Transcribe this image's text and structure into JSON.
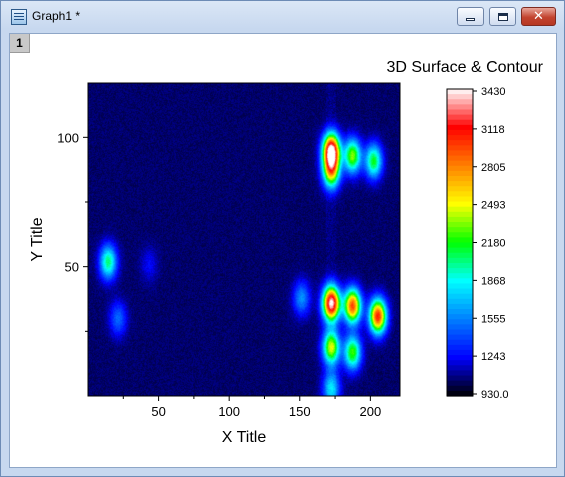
{
  "window": {
    "title": "Graph1 *",
    "layer_tab": "1",
    "buttons": {
      "minimize": "minimize-icon",
      "maximize": "maximize-icon",
      "close": "close-icon"
    }
  },
  "chart_data": {
    "type": "heatmap",
    "title": "3D Surface & Contour",
    "xlabel": "X Title",
    "ylabel": "Y Title",
    "xlim": [
      0,
      221
    ],
    "ylim": [
      0,
      121
    ],
    "x_ticks": [
      50,
      100,
      150,
      200
    ],
    "y_ticks": [
      50,
      100
    ],
    "x_minor_ticks": [
      25,
      75,
      125,
      175
    ],
    "y_minor_ticks": [
      25,
      75
    ],
    "z_range": [
      930.0,
      3430
    ],
    "colorbar_labels": [
      "3430",
      "3118",
      "2805",
      "2493",
      "2180",
      "1868",
      "1555",
      "1243",
      "930.0"
    ],
    "colormap": [
      "#000000",
      "#0000ff",
      "#0080ff",
      "#00ffff",
      "#00ff00",
      "#ffff00",
      "#ff8000",
      "#ff0000",
      "#ffffff"
    ],
    "background_level": 1060,
    "peaks": [
      {
        "x": 172,
        "y": 95,
        "z": 3430
      },
      {
        "x": 172,
        "y": 87,
        "z": 2500
      },
      {
        "x": 187,
        "y": 93,
        "z": 2350
      },
      {
        "x": 202,
        "y": 91,
        "z": 2150
      },
      {
        "x": 14,
        "y": 52,
        "z": 2050
      },
      {
        "x": 172,
        "y": 36,
        "z": 3430
      },
      {
        "x": 172,
        "y": 19,
        "z": 2450
      },
      {
        "x": 187,
        "y": 35,
        "z": 2950
      },
      {
        "x": 187,
        "y": 17,
        "z": 2250
      },
      {
        "x": 205,
        "y": 31,
        "z": 3050
      },
      {
        "x": 172,
        "y": 3,
        "z": 1800
      },
      {
        "x": 43,
        "y": 51,
        "z": 1250
      },
      {
        "x": 21,
        "y": 30,
        "z": 1500
      },
      {
        "x": 151,
        "y": 38,
        "z": 1600
      }
    ]
  }
}
